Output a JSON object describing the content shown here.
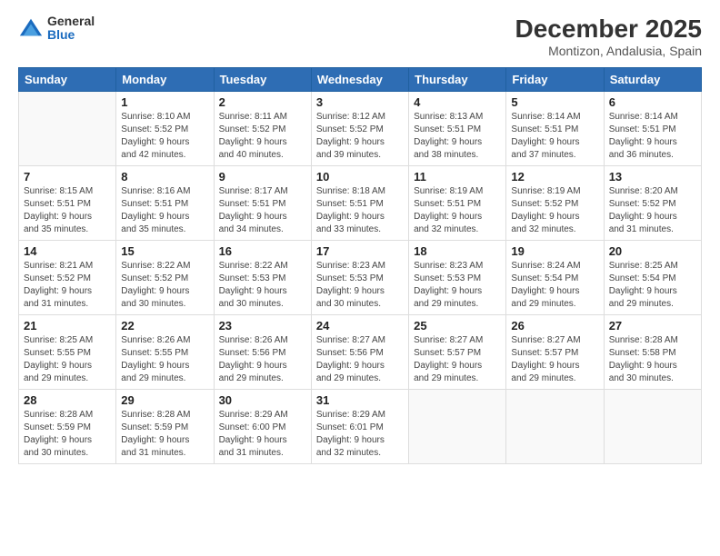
{
  "logo": {
    "general": "General",
    "blue": "Blue"
  },
  "title": "December 2025",
  "subtitle": "Montizon, Andalusia, Spain",
  "days_of_week": [
    "Sunday",
    "Monday",
    "Tuesday",
    "Wednesday",
    "Thursday",
    "Friday",
    "Saturday"
  ],
  "weeks": [
    [
      {
        "day": "",
        "info": ""
      },
      {
        "day": "1",
        "info": "Sunrise: 8:10 AM\nSunset: 5:52 PM\nDaylight: 9 hours\nand 42 minutes."
      },
      {
        "day": "2",
        "info": "Sunrise: 8:11 AM\nSunset: 5:52 PM\nDaylight: 9 hours\nand 40 minutes."
      },
      {
        "day": "3",
        "info": "Sunrise: 8:12 AM\nSunset: 5:52 PM\nDaylight: 9 hours\nand 39 minutes."
      },
      {
        "day": "4",
        "info": "Sunrise: 8:13 AM\nSunset: 5:51 PM\nDaylight: 9 hours\nand 38 minutes."
      },
      {
        "day": "5",
        "info": "Sunrise: 8:14 AM\nSunset: 5:51 PM\nDaylight: 9 hours\nand 37 minutes."
      },
      {
        "day": "6",
        "info": "Sunrise: 8:14 AM\nSunset: 5:51 PM\nDaylight: 9 hours\nand 36 minutes."
      }
    ],
    [
      {
        "day": "7",
        "info": "Sunrise: 8:15 AM\nSunset: 5:51 PM\nDaylight: 9 hours\nand 35 minutes."
      },
      {
        "day": "8",
        "info": "Sunrise: 8:16 AM\nSunset: 5:51 PM\nDaylight: 9 hours\nand 35 minutes."
      },
      {
        "day": "9",
        "info": "Sunrise: 8:17 AM\nSunset: 5:51 PM\nDaylight: 9 hours\nand 34 minutes."
      },
      {
        "day": "10",
        "info": "Sunrise: 8:18 AM\nSunset: 5:51 PM\nDaylight: 9 hours\nand 33 minutes."
      },
      {
        "day": "11",
        "info": "Sunrise: 8:19 AM\nSunset: 5:51 PM\nDaylight: 9 hours\nand 32 minutes."
      },
      {
        "day": "12",
        "info": "Sunrise: 8:19 AM\nSunset: 5:52 PM\nDaylight: 9 hours\nand 32 minutes."
      },
      {
        "day": "13",
        "info": "Sunrise: 8:20 AM\nSunset: 5:52 PM\nDaylight: 9 hours\nand 31 minutes."
      }
    ],
    [
      {
        "day": "14",
        "info": "Sunrise: 8:21 AM\nSunset: 5:52 PM\nDaylight: 9 hours\nand 31 minutes."
      },
      {
        "day": "15",
        "info": "Sunrise: 8:22 AM\nSunset: 5:52 PM\nDaylight: 9 hours\nand 30 minutes."
      },
      {
        "day": "16",
        "info": "Sunrise: 8:22 AM\nSunset: 5:53 PM\nDaylight: 9 hours\nand 30 minutes."
      },
      {
        "day": "17",
        "info": "Sunrise: 8:23 AM\nSunset: 5:53 PM\nDaylight: 9 hours\nand 30 minutes."
      },
      {
        "day": "18",
        "info": "Sunrise: 8:23 AM\nSunset: 5:53 PM\nDaylight: 9 hours\nand 29 minutes."
      },
      {
        "day": "19",
        "info": "Sunrise: 8:24 AM\nSunset: 5:54 PM\nDaylight: 9 hours\nand 29 minutes."
      },
      {
        "day": "20",
        "info": "Sunrise: 8:25 AM\nSunset: 5:54 PM\nDaylight: 9 hours\nand 29 minutes."
      }
    ],
    [
      {
        "day": "21",
        "info": "Sunrise: 8:25 AM\nSunset: 5:55 PM\nDaylight: 9 hours\nand 29 minutes."
      },
      {
        "day": "22",
        "info": "Sunrise: 8:26 AM\nSunset: 5:55 PM\nDaylight: 9 hours\nand 29 minutes."
      },
      {
        "day": "23",
        "info": "Sunrise: 8:26 AM\nSunset: 5:56 PM\nDaylight: 9 hours\nand 29 minutes."
      },
      {
        "day": "24",
        "info": "Sunrise: 8:27 AM\nSunset: 5:56 PM\nDaylight: 9 hours\nand 29 minutes."
      },
      {
        "day": "25",
        "info": "Sunrise: 8:27 AM\nSunset: 5:57 PM\nDaylight: 9 hours\nand 29 minutes."
      },
      {
        "day": "26",
        "info": "Sunrise: 8:27 AM\nSunset: 5:57 PM\nDaylight: 9 hours\nand 29 minutes."
      },
      {
        "day": "27",
        "info": "Sunrise: 8:28 AM\nSunset: 5:58 PM\nDaylight: 9 hours\nand 30 minutes."
      }
    ],
    [
      {
        "day": "28",
        "info": "Sunrise: 8:28 AM\nSunset: 5:59 PM\nDaylight: 9 hours\nand 30 minutes."
      },
      {
        "day": "29",
        "info": "Sunrise: 8:28 AM\nSunset: 5:59 PM\nDaylight: 9 hours\nand 31 minutes."
      },
      {
        "day": "30",
        "info": "Sunrise: 8:29 AM\nSunset: 6:00 PM\nDaylight: 9 hours\nand 31 minutes."
      },
      {
        "day": "31",
        "info": "Sunrise: 8:29 AM\nSunset: 6:01 PM\nDaylight: 9 hours\nand 32 minutes."
      },
      {
        "day": "",
        "info": ""
      },
      {
        "day": "",
        "info": ""
      },
      {
        "day": "",
        "info": ""
      }
    ]
  ]
}
